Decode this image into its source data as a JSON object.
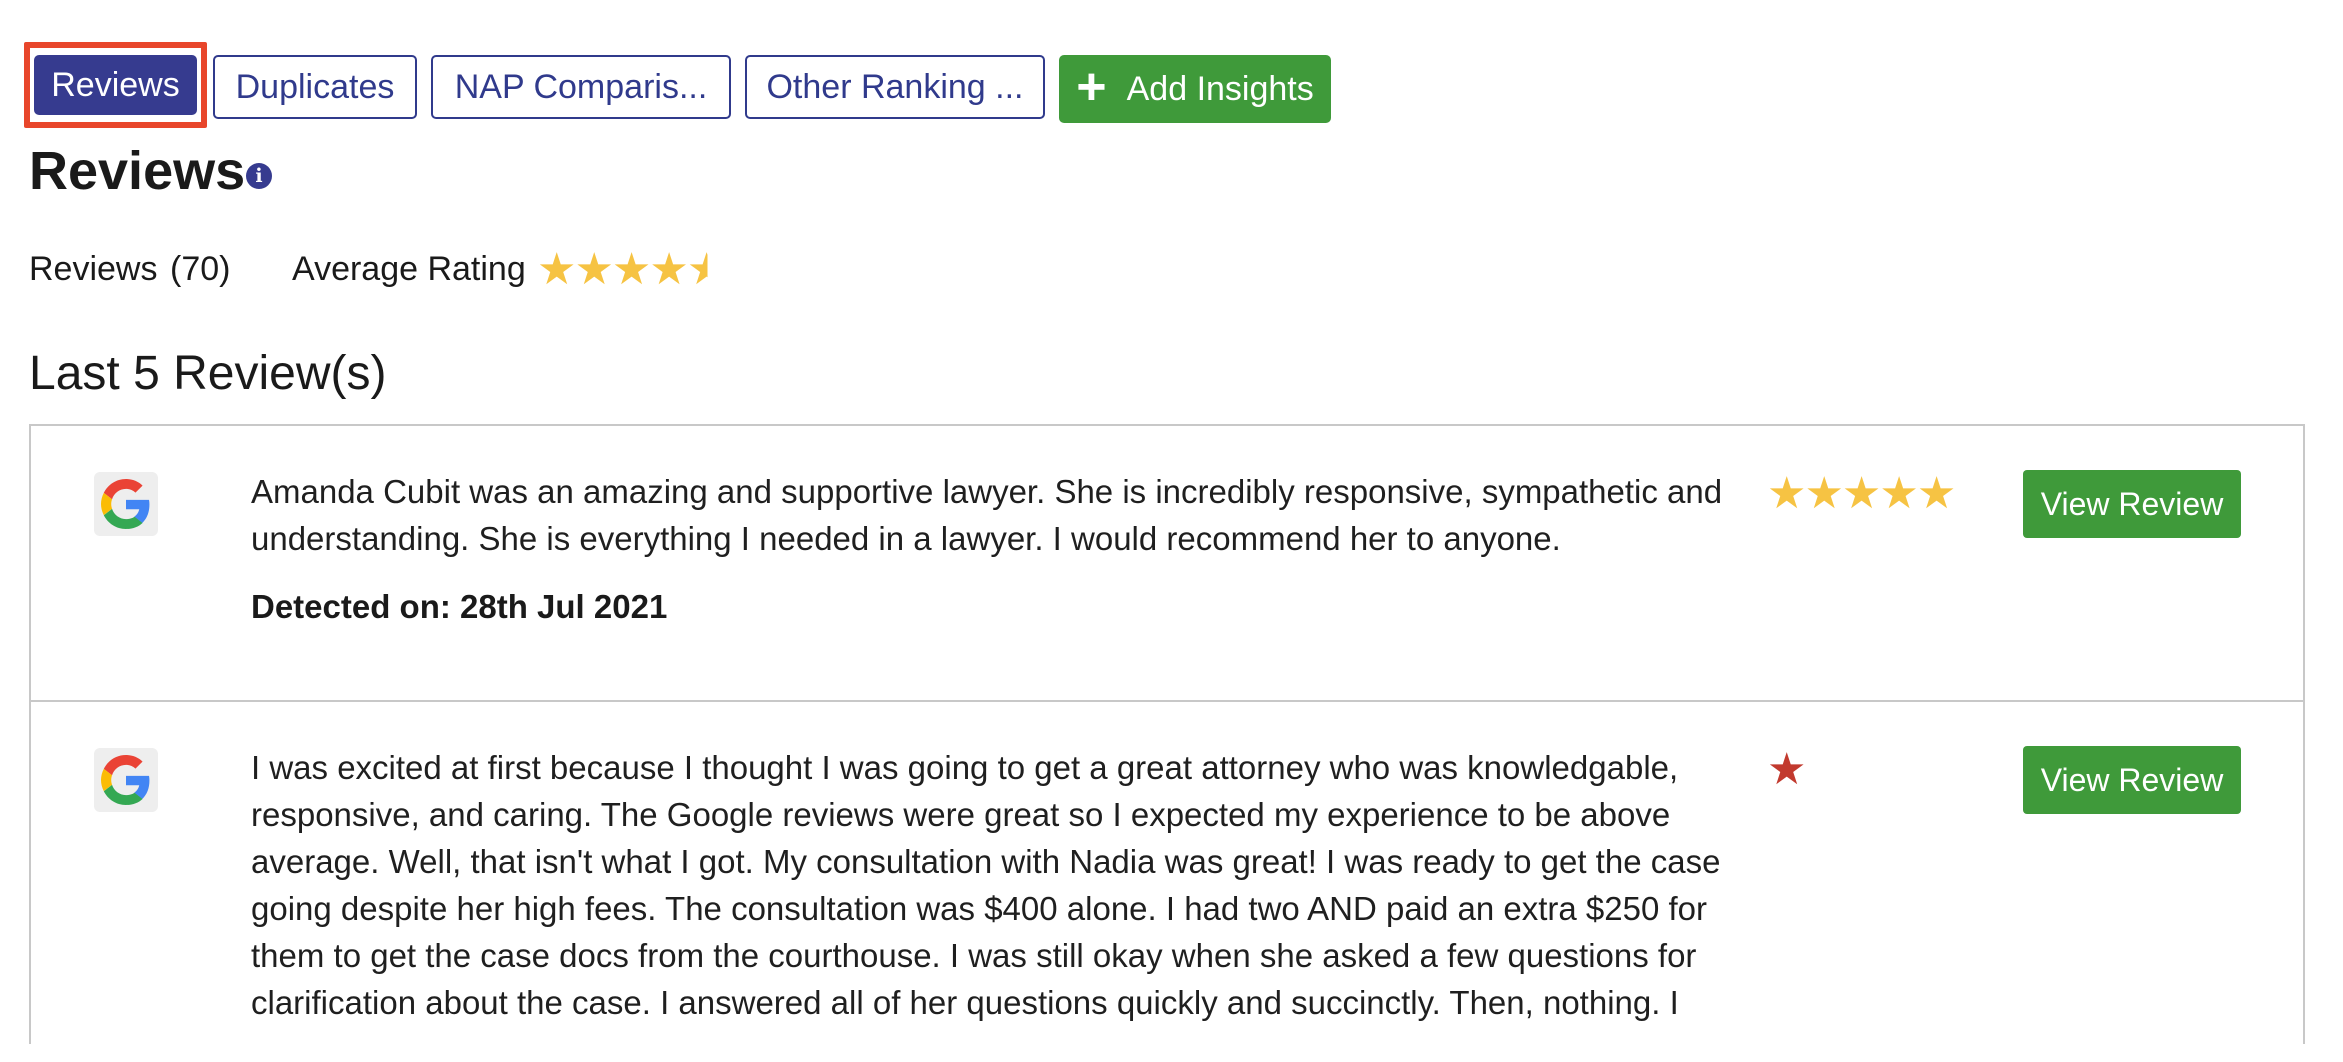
{
  "tabs": [
    {
      "label": "Reviews",
      "active": true
    },
    {
      "label": "Duplicates",
      "active": false
    },
    {
      "label": "NAP Comparis...",
      "active": false
    },
    {
      "label": "Other Ranking ...",
      "active": false
    }
  ],
  "add_insights": {
    "label": "Add Insights",
    "icon": "plus-icon"
  },
  "page_title": "Reviews",
  "info_icon": {
    "glyph": "i",
    "icon": "info-icon"
  },
  "stats": {
    "reviews_label": "Reviews",
    "reviews_count": "(70)",
    "avg_label": "Average Rating",
    "avg_rating_stars": 4.5
  },
  "section_title": "Last 5 Review(s)",
  "reviews": [
    {
      "source_icon": "google-icon",
      "text": "Amanda Cubit was an amazing and supportive lawyer. She is incredibly responsive, sympathetic and understanding. She is everything I needed in a lawyer. I would recommend her to anyone.",
      "detected": "Detected on: 28th Jul 2021",
      "stars": 5,
      "button": "View Review"
    },
    {
      "source_icon": "google-icon",
      "text": "I was excited at first because I thought I was going to get a great attorney who was knowledgable, responsive, and caring. The Google reviews were great so I expected my experience to be above average. Well, that isn't what I got. My consultation with Nadia was great! I was ready to get the case going despite her high fees. The consultation was $400 alone. I had two AND paid an extra $250 for them to get the case docs from the courthouse. I was still okay when she asked a few questions for clarification about the case. I answered all of her questions quickly and succinctly. Then, nothing. I",
      "detected": "",
      "stars": 1,
      "button": "View Review"
    }
  ],
  "colors": {
    "tab_border": "#303a8c",
    "tab_active_bg": "#363b8f",
    "focus_outline": "#e8462b",
    "green": "#3f9a3a",
    "star_gold": "#f6c343",
    "star_red": "#c23a2e"
  }
}
